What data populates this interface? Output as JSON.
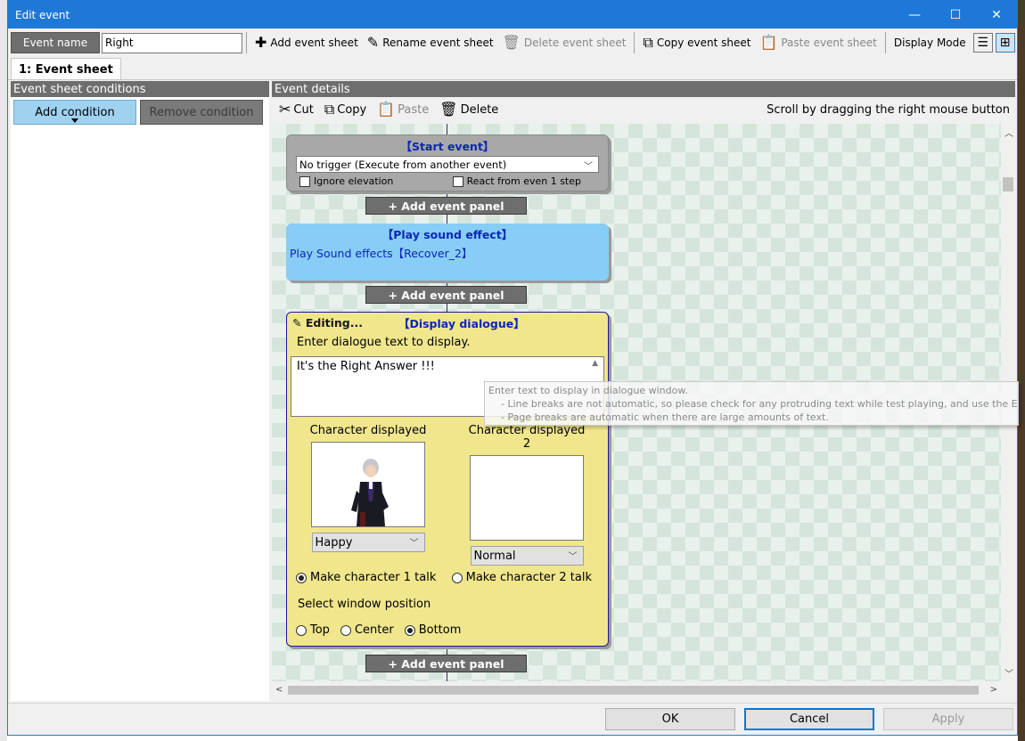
{
  "window": {
    "title": "Edit event",
    "controls": {
      "minimize": "—",
      "maximize": "☐",
      "close": "✕"
    }
  },
  "toolbar": {
    "name_label": "Event name",
    "name_value": "Right",
    "add_sheet": "Add event sheet",
    "rename_sheet": "Rename event sheet",
    "delete_sheet": "Delete event sheet",
    "copy_sheet": "Copy event sheet",
    "paste_sheet": "Paste event sheet",
    "display_mode": "Display Mode"
  },
  "tabs": [
    {
      "label": "1: Event sheet"
    }
  ],
  "left": {
    "header": "Event sheet conditions",
    "add_condition": "Add condition",
    "remove_condition": "Remove condition"
  },
  "right": {
    "header": "Event details",
    "cut": "Cut",
    "copy": "Copy",
    "paste": "Paste",
    "delete": "Delete",
    "scroll_hint": "Scroll by dragging the right mouse button"
  },
  "start_event": {
    "title": "【Start event】",
    "trigger": "No trigger (Execute from another event)",
    "ignore_elevation": "Ignore elevation",
    "react_step": "React from even 1 step"
  },
  "add_event_panel": "+ Add event panel",
  "sound_panel": {
    "title": "【Play sound effect】",
    "text": "Play Sound effects【Recover_2】"
  },
  "dialog_panel": {
    "editing": "Editing...",
    "title": "【Display dialogue】",
    "instruction": "Enter dialogue text to display.",
    "text": "It's the Right Answer !!!",
    "char1_label": "Character displayed",
    "char2_label": "Character displayed 2",
    "char1_expression": "Happy",
    "char2_expression": "Normal",
    "talk1": "Make character 1 talk",
    "talk2": "Make character 2 talk",
    "window_position_label": "Select window position",
    "pos_top": "Top",
    "pos_center": "Center",
    "pos_bottom": "Bottom"
  },
  "tooltip": {
    "line1": "Enter text to display in dialogue window.",
    "line2": "- Line breaks are not automatic, so please check for any protruding text while test playing, and use the Enter key",
    "line3": "- Page breaks are automatic when there are large amounts of text."
  },
  "buttons": {
    "ok": "OK",
    "cancel": "Cancel",
    "apply": "Apply"
  },
  "colors": {
    "accent": "#1e78d7",
    "sound_panel": "#87cdf5",
    "dialog_panel": "#f0e68c",
    "title_blue": "#0a28b4"
  }
}
